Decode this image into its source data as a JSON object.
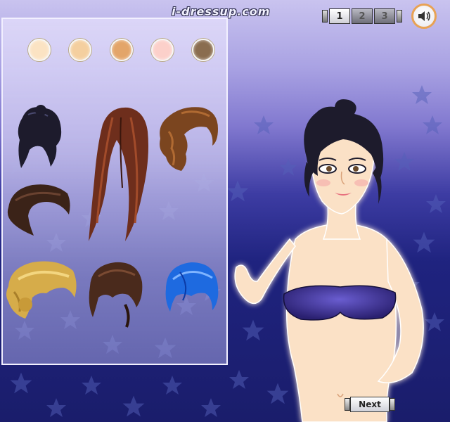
{
  "header": {
    "site_logo": "i-dressup.com",
    "steps": [
      "1",
      "2",
      "3"
    ],
    "active_step": "1",
    "sound_icon": "speaker-icon"
  },
  "panel": {
    "skin_tones": [
      "#fbe3c3",
      "#f4cf9f",
      "#e3a569",
      "#fcd0ca",
      "#8a6d4f"
    ],
    "hair_options": [
      {
        "name": "black-updo",
        "color": "#1d1b2c"
      },
      {
        "name": "long-auburn",
        "color": "#6e2e1c"
      },
      {
        "name": "wavy-brown-side",
        "color": "#7b451f"
      },
      {
        "name": "dark-brown-swept",
        "color": "#3b2318"
      },
      {
        "name": "blonde-updo",
        "color": "#d6ac4a"
      },
      {
        "name": "brown-pixie",
        "color": "#4a2a1c"
      },
      {
        "name": "blue-bob",
        "color": "#1e6ae0"
      }
    ]
  },
  "doll": {
    "hair_color": "#1d1b2c",
    "skin_color": "#fbe1c6",
    "top_color": "#3b2f8c"
  },
  "footer": {
    "next_label": "Next"
  },
  "colors": {
    "panel_border": "#f2f0ff",
    "sound_ring": "#e8a254",
    "star": "#2a3a8f"
  }
}
